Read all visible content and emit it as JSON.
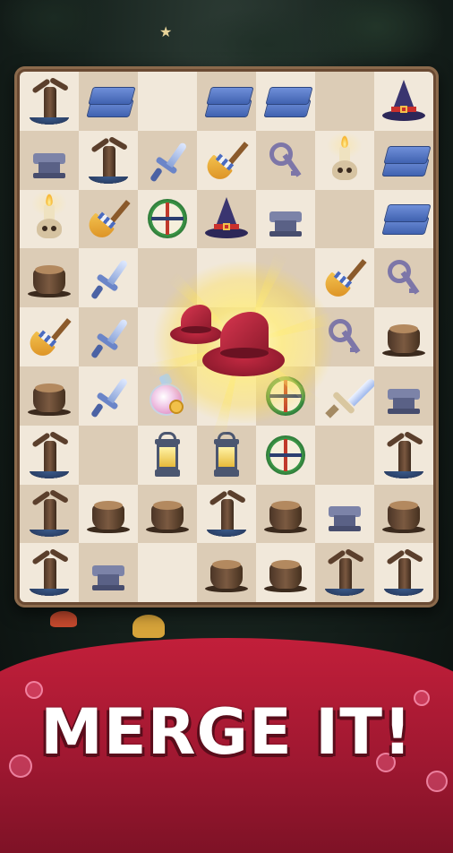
{
  "game": {
    "cta_text": "MERGE IT!",
    "board": {
      "columns": 7,
      "rows": 9,
      "cells": [
        [
          "tree",
          "planks",
          "",
          "planks",
          "planks",
          "",
          "witch-hat"
        ],
        [
          "anvil",
          "tree",
          "dagger",
          "broom",
          "key",
          "candle-skull",
          "planks"
        ],
        [
          "candle-skull",
          "broom",
          "compass",
          "witch-hat",
          "anvil",
          "",
          "planks"
        ],
        [
          "stump",
          "dagger",
          "",
          "",
          "",
          "broom",
          "key"
        ],
        [
          "broom",
          "dagger",
          "",
          "",
          "",
          "key",
          "stump"
        ],
        [
          "stump",
          "dagger",
          "potion",
          "",
          "compass",
          "sword",
          "anvil"
        ],
        [
          "tree",
          "",
          "lantern",
          "lantern",
          "compass",
          "",
          "tree"
        ],
        [
          "tree",
          "stump",
          "stump",
          "tree",
          "stump",
          "anvil",
          "stump"
        ],
        [
          "tree",
          "anvil",
          "",
          "stump",
          "stump",
          "tree",
          "tree"
        ]
      ]
    },
    "merge_effect": {
      "item": "red-witch-hat",
      "count": 2
    }
  },
  "colors": {
    "board_frame": "#6a4a33",
    "cell_light": "#f1e8da",
    "cell_dark": "#dcccb6",
    "banner": "#c21f3a",
    "cta_text": "#ffffff"
  }
}
